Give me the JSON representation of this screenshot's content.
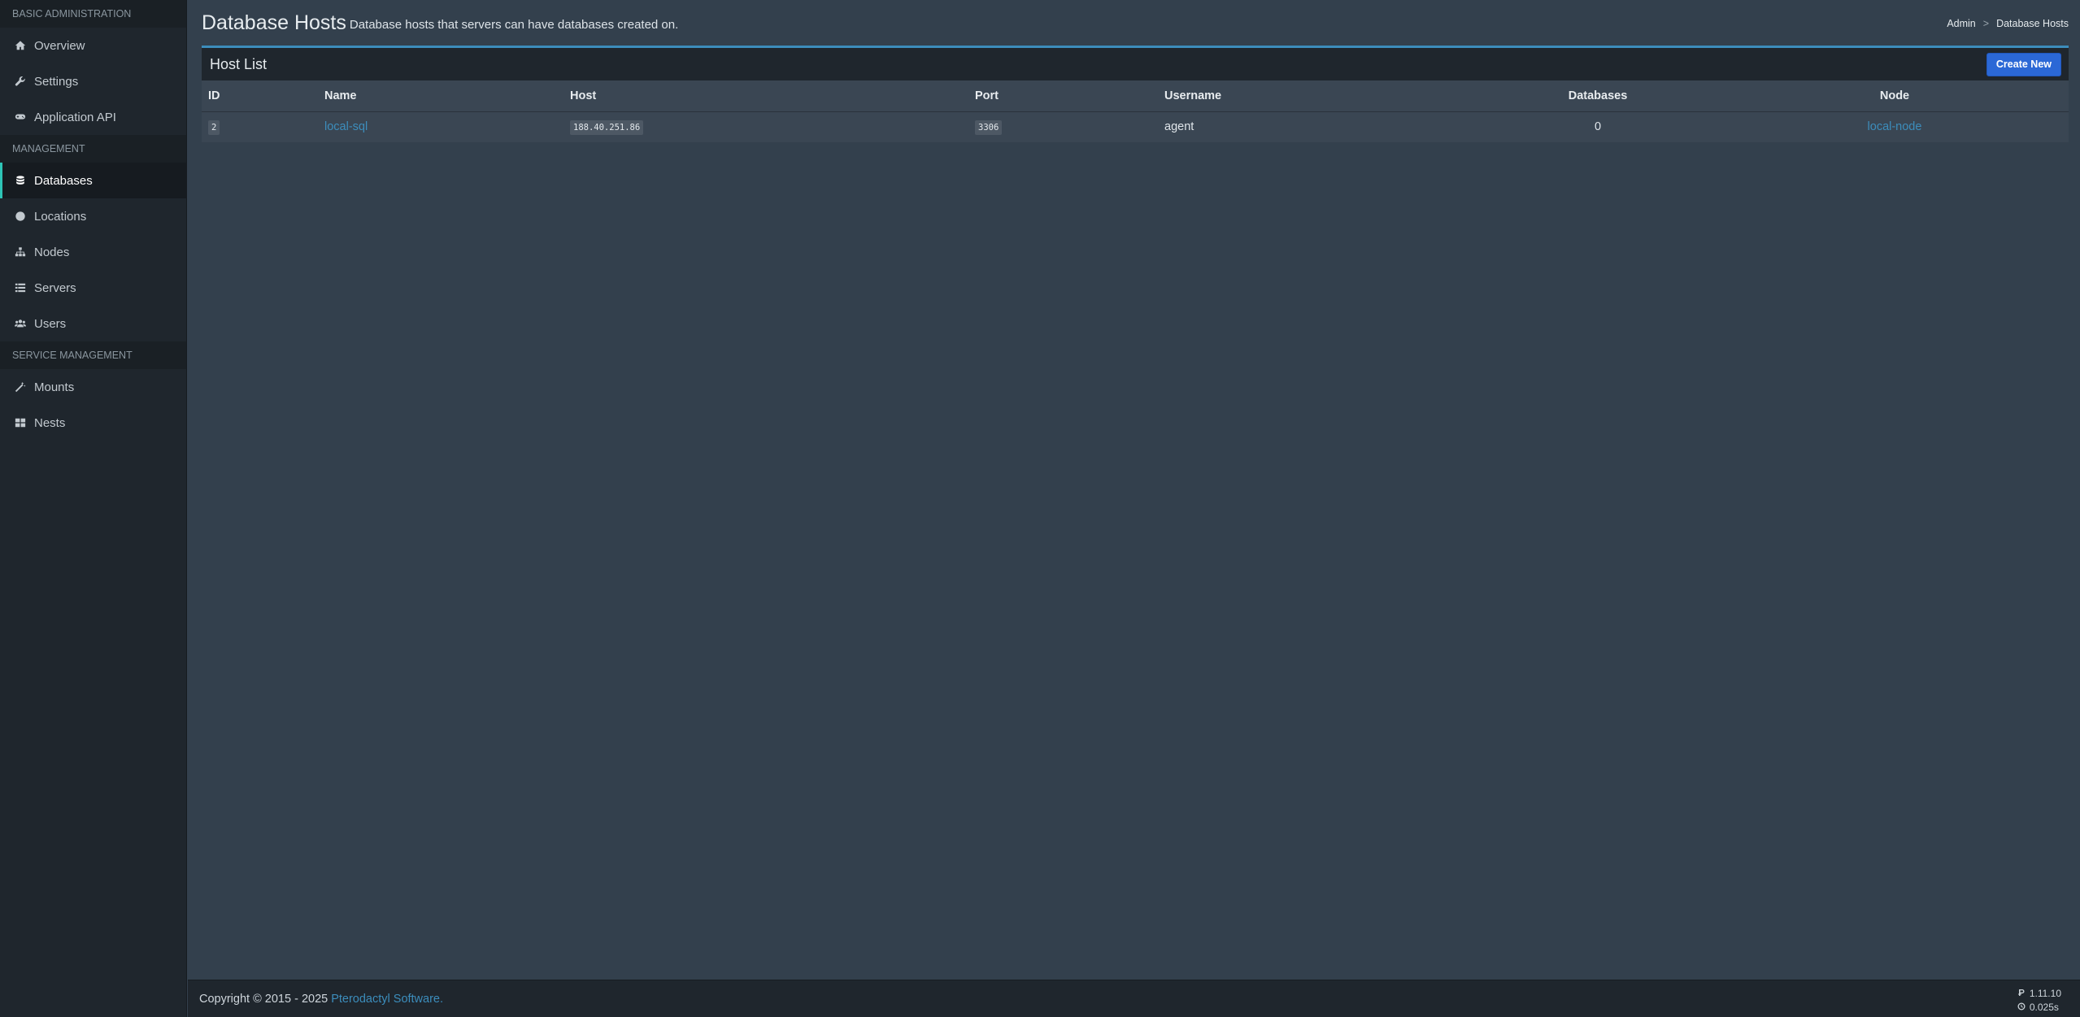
{
  "sidebar": {
    "sections": [
      {
        "header": "Basic Administration",
        "items": [
          {
            "label": "Overview",
            "icon": "home-icon"
          },
          {
            "label": "Settings",
            "icon": "wrench-icon"
          },
          {
            "label": "Application API",
            "icon": "gamepad-icon"
          }
        ]
      },
      {
        "header": "Management",
        "items": [
          {
            "label": "Databases",
            "icon": "database-icon",
            "active": true
          },
          {
            "label": "Locations",
            "icon": "globe-icon"
          },
          {
            "label": "Nodes",
            "icon": "sitemap-icon"
          },
          {
            "label": "Servers",
            "icon": "list-icon"
          },
          {
            "label": "Users",
            "icon": "users-icon"
          }
        ]
      },
      {
        "header": "Service Management",
        "items": [
          {
            "label": "Mounts",
            "icon": "magic-icon"
          },
          {
            "label": "Nests",
            "icon": "th-large-icon"
          }
        ]
      }
    ]
  },
  "header": {
    "title": "Database Hosts",
    "subtitle": "Database hosts that servers can have databases created on.",
    "breadcrumb": [
      "Admin",
      "Database Hosts"
    ],
    "breadcrumb_sep": ">"
  },
  "box": {
    "title": "Host List",
    "create_label": "Create New",
    "columns": [
      "ID",
      "Name",
      "Host",
      "Port",
      "Username",
      "Databases",
      "Node"
    ],
    "rows": [
      {
        "id": "2",
        "name": "local-sql",
        "host": "188.40.251.86",
        "port": "3306",
        "username": "agent",
        "databases": "0",
        "node": "local-node"
      }
    ]
  },
  "footer": {
    "copyright": "Copyright © 2015 - 2025",
    "brand": "Pterodactyl Software.",
    "version": "1.11.10",
    "time": "0.025s"
  },
  "colors": {
    "accent": "#3c8dbc",
    "active_indicator": "#2ec4b6",
    "button": "#2b68d6"
  }
}
